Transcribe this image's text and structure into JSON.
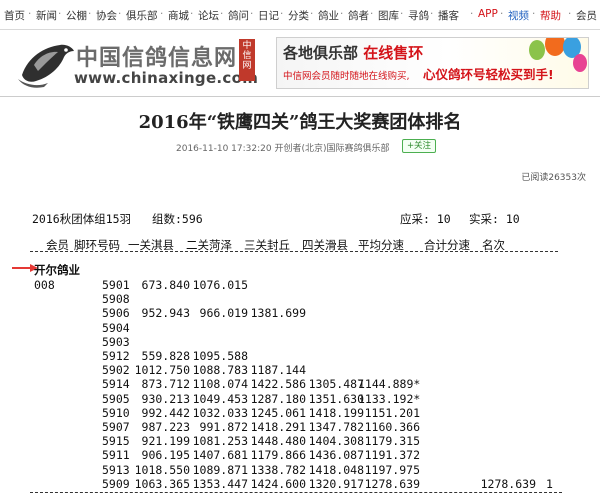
{
  "topnav": {
    "items": [
      "首页",
      "新闻",
      "公棚",
      "协会",
      "俱乐部",
      "商城",
      "论坛",
      "鸽问",
      "日记",
      "分类",
      "鸽业",
      "鸽者",
      "图库",
      "寻鸽",
      "播客",
      "APP",
      "视频",
      "帮助",
      "会员"
    ],
    "separator": "·",
    "colors": {
      "default": "#333333",
      "app": "#d4141a",
      "video": "#1e5fbf",
      "help": "#d4141a"
    }
  },
  "header": {
    "logo_title": "中国信鸽信息网",
    "logo_url": "www.chinaxinge.com",
    "logo_icon": "pigeon-icon",
    "stamp": "中信网"
  },
  "banner": {
    "line1_prefix": "各地俱乐部",
    "line1_highlight": "在线售环",
    "line2_left": "中信网会员随时随地在线购买,",
    "line2_right": "心仪鸽环号轻松买到手!",
    "accent": "#d4141a"
  },
  "article": {
    "title": "2016年“铁鹰四关”鸽王大奖赛团体排名",
    "meta": "2016-11-10 17:32:20   开创者(北京)国际赛鸽俱乐部",
    "follow_label": "+关注",
    "reads": "已阅读26353次"
  },
  "results": {
    "group_title": "2016秋团体组15羽",
    "group_count": "组数:596",
    "stat_should": "应采: 10",
    "stat_actual": "实采: 10",
    "headers": [
      "会员",
      "脚环号码",
      "一关淇县",
      "二关菏泽",
      "三关封丘",
      "四关滑县",
      "平均分速",
      "合计分速",
      "名次"
    ],
    "club_name": "开尔鸽业",
    "rows": [
      {
        "member": "008",
        "ring": "5901",
        "v1": "673.840",
        "v2": "1076.015",
        "v3": "",
        "v4": "",
        "avg": "",
        "total": "",
        "rank": ""
      },
      {
        "member": "",
        "ring": "5908",
        "v1": "",
        "v2": "",
        "v3": "",
        "v4": "",
        "avg": "",
        "total": "",
        "rank": ""
      },
      {
        "member": "",
        "ring": "5906",
        "v1": "952.943",
        "v2": "966.019",
        "v3": "1381.699",
        "v4": "",
        "avg": "",
        "total": "",
        "rank": ""
      },
      {
        "member": "",
        "ring": "5904",
        "v1": "",
        "v2": "",
        "v3": "",
        "v4": "",
        "avg": "",
        "total": "",
        "rank": ""
      },
      {
        "member": "",
        "ring": "5903",
        "v1": "",
        "v2": "",
        "v3": "",
        "v4": "",
        "avg": "",
        "total": "",
        "rank": ""
      },
      {
        "member": "",
        "ring": "5912",
        "v1": "559.828",
        "v2": "1095.588",
        "v3": "",
        "v4": "",
        "avg": "",
        "total": "",
        "rank": ""
      },
      {
        "member": "",
        "ring": "5902",
        "v1": "1012.750",
        "v2": "1088.783",
        "v3": "1187.144",
        "v4": "",
        "avg": "",
        "total": "",
        "rank": ""
      },
      {
        "member": "",
        "ring": "5914",
        "v1": "873.712",
        "v2": "1108.074",
        "v3": "1422.586",
        "v4": "1305.487",
        "avg": "1144.889*",
        "total": "",
        "rank": ""
      },
      {
        "member": "",
        "ring": "5905",
        "v1": "930.213",
        "v2": "1049.453",
        "v3": "1287.180",
        "v4": "1351.630",
        "avg": "1133.192*",
        "total": "",
        "rank": ""
      },
      {
        "member": "",
        "ring": "5910",
        "v1": "992.442",
        "v2": "1032.033",
        "v3": "1245.061",
        "v4": "1418.199",
        "avg": "1151.201",
        "total": "",
        "rank": ""
      },
      {
        "member": "",
        "ring": "5907",
        "v1": "987.223",
        "v2": "991.872",
        "v3": "1418.291",
        "v4": "1347.782",
        "avg": "1160.366",
        "total": "",
        "rank": ""
      },
      {
        "member": "",
        "ring": "5915",
        "v1": "921.199",
        "v2": "1081.253",
        "v3": "1448.480",
        "v4": "1404.308",
        "avg": "1179.315",
        "total": "",
        "rank": ""
      },
      {
        "member": "",
        "ring": "5911",
        "v1": "906.195",
        "v2": "1407.681",
        "v3": "1179.866",
        "v4": "1436.087",
        "avg": "1191.372",
        "total": "",
        "rank": ""
      },
      {
        "member": "",
        "ring": "5913",
        "v1": "1018.550",
        "v2": "1089.871",
        "v3": "1338.782",
        "v4": "1418.048",
        "avg": "1197.975",
        "total": "",
        "rank": ""
      },
      {
        "member": "",
        "ring": "5909",
        "v1": "1063.365",
        "v2": "1353.447",
        "v3": "1424.600",
        "v4": "1320.917",
        "avg": "1278.639",
        "total": "1278.639",
        "rank": "1"
      }
    ]
  }
}
